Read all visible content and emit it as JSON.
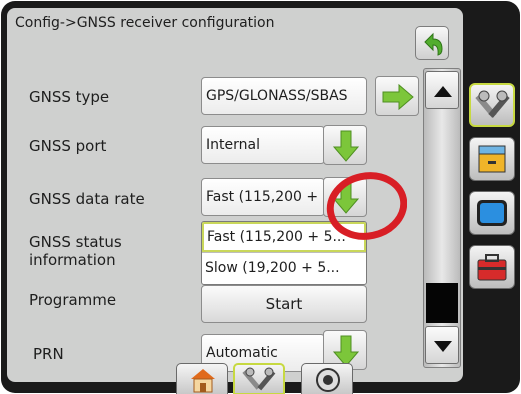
{
  "screen": {
    "breadcrumb": "Config->GNSS receiver configuration"
  },
  "rows": {
    "gnss_type": {
      "label": "GNSS type",
      "value": "GPS/GLONASS/SBAS"
    },
    "gnss_port": {
      "label": "GNSS port",
      "value": "Internal"
    },
    "gnss_data_rate": {
      "label": "GNSS data rate",
      "value": "Fast (115,200 + 5..."
    },
    "gnss_status": {
      "label_line1": "GNSS status",
      "label_line2": "information"
    },
    "programme": {
      "label": "Programme",
      "button": "Start"
    },
    "prn": {
      "label": "PRN",
      "value": "Automatic"
    }
  },
  "dropdown": {
    "options": [
      "Fast (115,200 + 5...",
      "Slow (19,200 + 5..."
    ],
    "selected_index": 0
  },
  "icons": {
    "back": "back-arrow-icon",
    "next": "green-right-arrow-icon",
    "expand": "green-down-arrow-icon",
    "side_tabs": [
      "tools-icon",
      "data-drawer-icon",
      "display-icon",
      "toolbox-icon"
    ],
    "bottom_tabs": [
      "home-icon",
      "tools-icon",
      "settings-dial-icon"
    ]
  },
  "colors": {
    "accent_green": "#7cc63a",
    "selected_outline": "#c7d941",
    "annotation_red": "#d81e25",
    "panel_bg": "#cfd0cf"
  }
}
